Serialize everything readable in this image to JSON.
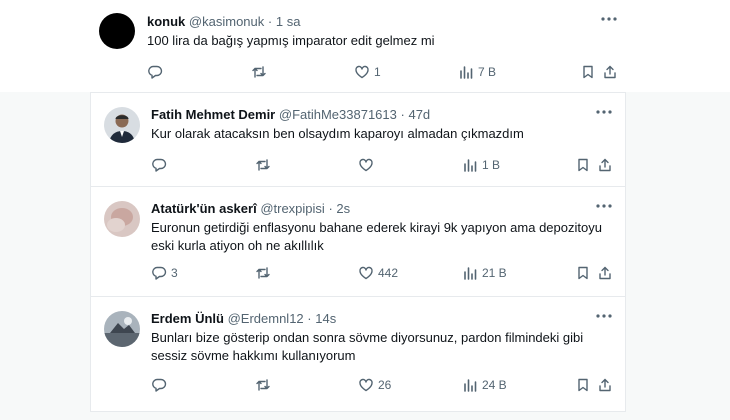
{
  "tweets": [
    {
      "name": "konuk",
      "handle": "@kasimonuk",
      "time": "1 sa",
      "text": "100 lira da bağış yapmış imparator edit gelmez mi",
      "replies": "",
      "retweets": "",
      "likes": "1",
      "views": "7 B"
    },
    {
      "name": "Fatih Mehmet Demir",
      "handle": "@FatihMe33871613",
      "time": "47d",
      "text": "Kur olarak atacaksın ben olsaydım kaparoyı almadan çıkmazdım",
      "replies": "",
      "retweets": "",
      "likes": "",
      "views": "1 B"
    },
    {
      "name": "Atatürk'ün askerî",
      "handle": "@trexpipisi",
      "time": "2s",
      "text": "Euronun getirdiği enflasyonu bahane ederek kirayi 9k yapıyon ama depozitoyu eski kurla atiyon oh ne akıllılık",
      "replies": "3",
      "retweets": "",
      "likes": "442",
      "views": "21 B"
    },
    {
      "name": "Erdem Ünlü",
      "handle": "@Erdemnl12",
      "time": "14s",
      "text": "Bunları bize gösterip ondan sonra sövme diyorsunuz, pardon filmindeki gibi sessiz sövme hakkımı kullanıyorum",
      "replies": "",
      "retweets": "",
      "likes": "26",
      "views": "24 B"
    }
  ],
  "separator": "·",
  "icons": {
    "reply": "reply-icon",
    "retweet": "retweet-icon",
    "like": "heart-icon",
    "views": "views-icon",
    "bookmark": "bookmark-icon",
    "share": "share-icon",
    "more": "more-icon"
  },
  "colors": {
    "text": "#0f1419",
    "muted": "#536471",
    "border": "#e7eaed"
  }
}
